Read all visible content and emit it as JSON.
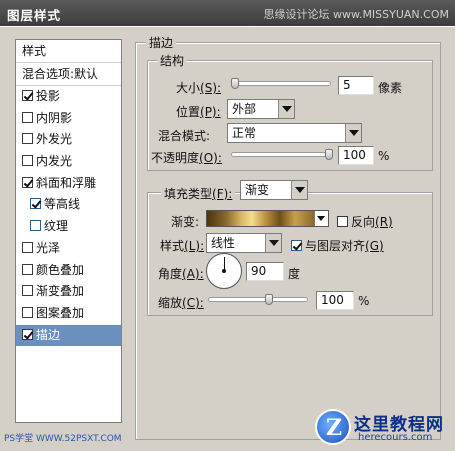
{
  "window": {
    "title": "图层样式",
    "watermark": "思缘设计论坛 www.MISSYUAN.COM"
  },
  "left_panel": {
    "header": "样式",
    "blend_options": "混合选项:默认",
    "items": [
      {
        "label": "投影",
        "checked": true
      },
      {
        "label": "内阴影",
        "checked": false
      },
      {
        "label": "外发光",
        "checked": false
      },
      {
        "label": "内发光",
        "checked": false
      },
      {
        "label": "斜面和浮雕",
        "checked": true
      },
      {
        "label": "等高线",
        "checked": true,
        "sub": true
      },
      {
        "label": "纹理",
        "checked": false,
        "sub": true
      },
      {
        "label": "光泽",
        "checked": false
      },
      {
        "label": "颜色叠加",
        "checked": false
      },
      {
        "label": "渐变叠加",
        "checked": false
      },
      {
        "label": "图案叠加",
        "checked": false
      },
      {
        "label": "描边",
        "checked": true,
        "selected": true
      }
    ]
  },
  "stroke": {
    "section_title": "描边",
    "structure": {
      "title": "结构",
      "size_label": "大小",
      "size_key": "(S):",
      "size_value": "5",
      "size_unit": "像素",
      "position_label": "位置",
      "position_key": "(P):",
      "position_value": "外部",
      "blend_label": "混合模式:",
      "blend_value": "正常",
      "opacity_label": "不透明度",
      "opacity_key": "(O):",
      "opacity_value": "100",
      "opacity_unit": "%"
    },
    "fill": {
      "fill_type_label": "填充类型",
      "fill_type_key": "(F):",
      "fill_type_value": "渐变",
      "gradient_label": "渐变:",
      "reverse_label": "反向",
      "reverse_key": "(R)",
      "style_label": "样式",
      "style_key": "(L):",
      "style_value": "线性",
      "align_label": "与图层对齐",
      "align_key": "(G)",
      "align_checked": true,
      "angle_label": "角度",
      "angle_key": "(A):",
      "angle_value": "90",
      "angle_unit": "度",
      "scale_label": "缩放",
      "scale_key": "(C):",
      "scale_value": "100",
      "scale_unit": "%"
    }
  },
  "watermarks": {
    "left": "PS学堂 WWW.52PSXT.COM",
    "right_title": "这里教程网",
    "right_url": "herecours.com",
    "logo_letter": "Z"
  }
}
